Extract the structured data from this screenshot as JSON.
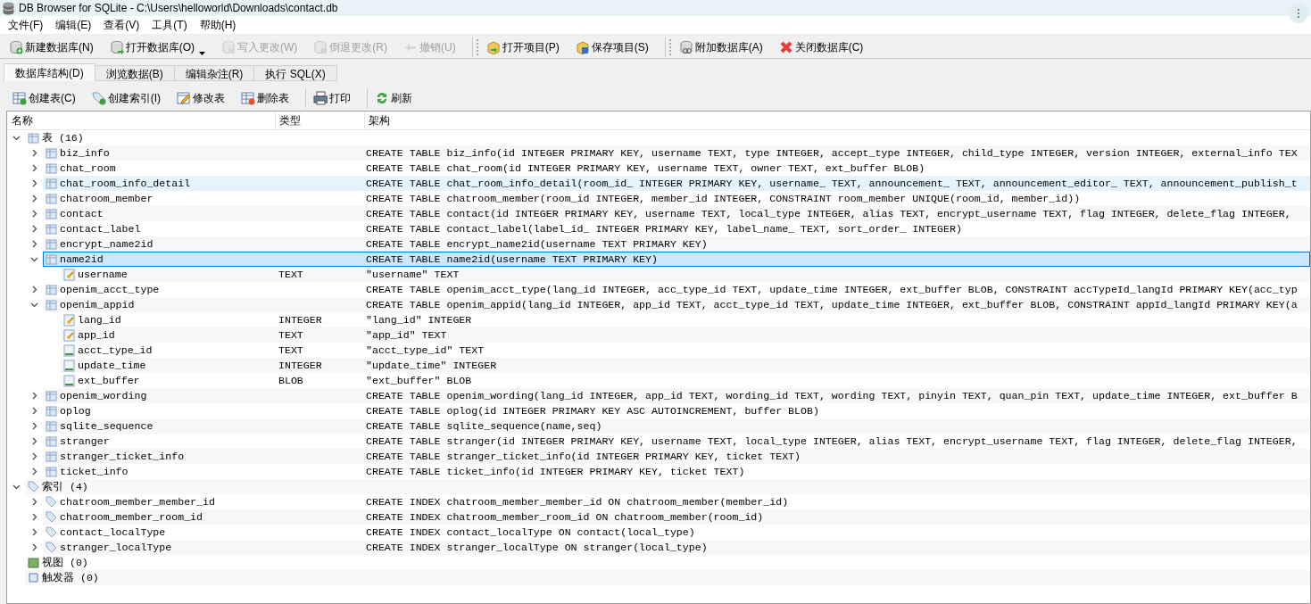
{
  "window": {
    "title": "DB Browser for SQLite - C:\\Users\\helloworld\\Downloads\\contact.db"
  },
  "menu": [
    "文件(F)",
    "编辑(E)",
    "查看(V)",
    "工具(T)",
    "帮助(H)"
  ],
  "toolbar": [
    [
      {
        "kind": "newdb",
        "label": "新建数据库(N)",
        "disabled": false,
        "dropdown": false
      },
      {
        "kind": "opendb",
        "label": "打开数据库(O)",
        "disabled": false,
        "dropdown": true
      },
      {
        "kind": "write",
        "label": "写入更改(W)",
        "disabled": true,
        "dropdown": false
      },
      {
        "kind": "revert",
        "label": "倒退更改(R)",
        "disabled": true,
        "dropdown": false
      },
      {
        "kind": "undo",
        "label": "撤销(U)",
        "disabled": true,
        "dropdown": false
      }
    ],
    [
      {
        "kind": "openproject",
        "label": "打开项目(P)",
        "disabled": false,
        "dropdown": false
      },
      {
        "kind": "saveproject",
        "label": "保存项目(S)",
        "disabled": false,
        "dropdown": false
      }
    ],
    [
      {
        "kind": "attach",
        "label": "附加数据库(A)",
        "disabled": false,
        "dropdown": false
      },
      {
        "kind": "close",
        "label": "关闭数据库(C)",
        "disabled": false,
        "dropdown": false
      }
    ]
  ],
  "tabs": [
    {
      "label": "数据库结构(D)",
      "selected": true
    },
    {
      "label": "浏览数据(B)",
      "selected": false
    },
    {
      "label": "编辑杂注(R)",
      "selected": false
    },
    {
      "label": "执行 SQL(X)",
      "selected": false
    }
  ],
  "structure_toolbar": [
    [
      {
        "kind": "createtable",
        "label": "创建表(C)"
      },
      {
        "kind": "createindex",
        "label": "创建索引(I)"
      },
      {
        "kind": "modifytable",
        "label": "修改表"
      },
      {
        "kind": "deletetable",
        "label": "删除表"
      }
    ],
    [
      {
        "kind": "print",
        "label": "打印"
      }
    ],
    [
      {
        "kind": "refresh",
        "label": "刷新"
      }
    ]
  ],
  "tree": {
    "columns": [
      "名称",
      "类型",
      "架构"
    ],
    "groups": [
      {
        "kind": "tables",
        "label": "表 (16)",
        "expanded": true,
        "children": [
          {
            "name": "biz_info",
            "schema": "CREATE TABLE biz_info(id INTEGER PRIMARY KEY, username TEXT, type INTEGER, accept_type INTEGER, child_type INTEGER, version INTEGER, external_info TEX",
            "expanded": false,
            "selected": false,
            "hovered": false
          },
          {
            "name": "chat_room",
            "schema": "CREATE TABLE chat_room(id INTEGER PRIMARY KEY, username TEXT, owner TEXT, ext_buffer BLOB)",
            "expanded": false,
            "selected": false,
            "hovered": false
          },
          {
            "name": "chat_room_info_detail",
            "schema": "CREATE TABLE chat_room_info_detail(room_id_ INTEGER PRIMARY KEY, username_ TEXT, announcement_ TEXT, announcement_editor_ TEXT, announcement_publish_t",
            "expanded": false,
            "selected": false,
            "hovered": true
          },
          {
            "name": "chatroom_member",
            "schema": "CREATE TABLE chatroom_member(room_id INTEGER, member_id INTEGER, CONSTRAINT room_member UNIQUE(room_id, member_id))",
            "expanded": false,
            "selected": false,
            "hovered": false
          },
          {
            "name": "contact",
            "schema": "CREATE TABLE contact(id INTEGER PRIMARY KEY, username TEXT, local_type INTEGER, alias TEXT, encrypt_username TEXT, flag INTEGER, delete_flag INTEGER,",
            "expanded": false,
            "selected": false,
            "hovered": false
          },
          {
            "name": "contact_label",
            "schema": "CREATE TABLE contact_label(label_id_ INTEGER PRIMARY KEY, label_name_ TEXT, sort_order_ INTEGER)",
            "expanded": false,
            "selected": false,
            "hovered": false
          },
          {
            "name": "encrypt_name2id",
            "schema": "CREATE TABLE encrypt_name2id(username TEXT PRIMARY KEY)",
            "expanded": false,
            "selected": false,
            "hovered": false
          },
          {
            "name": "name2id",
            "schema": "CREATE TABLE name2id(username TEXT PRIMARY KEY)",
            "expanded": true,
            "selected": true,
            "hovered": false,
            "children": [
              {
                "name": "username",
                "type": "TEXT",
                "schema": "\"username\" TEXT",
                "primary_key": true
              }
            ]
          },
          {
            "name": "openim_acct_type",
            "schema": "CREATE TABLE openim_acct_type(lang_id INTEGER, acc_type_id TEXT, update_time INTEGER, ext_buffer BLOB, CONSTRAINT accTypeId_langId PRIMARY KEY(acc_typ",
            "expanded": false,
            "selected": false,
            "hovered": false
          },
          {
            "name": "openim_appid",
            "schema": "CREATE TABLE openim_appid(lang_id INTEGER, app_id TEXT, acct_type_id TEXT, update_time INTEGER, ext_buffer BLOB, CONSTRAINT appId_langId PRIMARY KEY(a",
            "expanded": true,
            "selected": false,
            "hovered": false,
            "children": [
              {
                "name": "lang_id",
                "type": "INTEGER",
                "schema": "\"lang_id\" INTEGER",
                "primary_key": true
              },
              {
                "name": "app_id",
                "type": "TEXT",
                "schema": "\"app_id\" TEXT",
                "primary_key": true
              },
              {
                "name": "acct_type_id",
                "type": "TEXT",
                "schema": "\"acct_type_id\" TEXT",
                "primary_key": false
              },
              {
                "name": "update_time",
                "type": "INTEGER",
                "schema": "\"update_time\" INTEGER",
                "primary_key": false
              },
              {
                "name": "ext_buffer",
                "type": "BLOB",
                "schema": "\"ext_buffer\" BLOB",
                "primary_key": false
              }
            ]
          },
          {
            "name": "openim_wording",
            "schema": "CREATE TABLE openim_wording(lang_id INTEGER, app_id TEXT, wording_id TEXT, wording TEXT, pinyin TEXT, quan_pin TEXT, update_time INTEGER, ext_buffer B",
            "expanded": false,
            "selected": false,
            "hovered": false
          },
          {
            "name": "oplog",
            "schema": "CREATE TABLE oplog(id INTEGER PRIMARY KEY ASC AUTOINCREMENT, buffer BLOB)",
            "expanded": false,
            "selected": false,
            "hovered": false
          },
          {
            "name": "sqlite_sequence",
            "schema": "CREATE TABLE sqlite_sequence(name,seq)",
            "expanded": false,
            "selected": false,
            "hovered": false
          },
          {
            "name": "stranger",
            "schema": "CREATE TABLE stranger(id INTEGER PRIMARY KEY, username TEXT, local_type INTEGER, alias TEXT, encrypt_username TEXT, flag INTEGER, delete_flag INTEGER,",
            "expanded": false,
            "selected": false,
            "hovered": false
          },
          {
            "name": "stranger_ticket_info",
            "schema": "CREATE TABLE stranger_ticket_info(id INTEGER PRIMARY KEY, ticket TEXT)",
            "expanded": false,
            "selected": false,
            "hovered": false
          },
          {
            "name": "ticket_info",
            "schema": "CREATE TABLE ticket_info(id INTEGER PRIMARY KEY, ticket TEXT)",
            "expanded": false,
            "selected": false,
            "hovered": false
          }
        ]
      },
      {
        "kind": "indices",
        "label": "索引 (4)",
        "expanded": true,
        "children": [
          {
            "name": "chatroom_member_member_id",
            "schema": "CREATE INDEX chatroom_member_member_id ON chatroom_member(member_id)",
            "expanded": false,
            "selected": false,
            "hovered": false
          },
          {
            "name": "chatroom_member_room_id",
            "schema": "CREATE INDEX chatroom_member_room_id ON chatroom_member(room_id)",
            "expanded": false,
            "selected": false,
            "hovered": false
          },
          {
            "name": "contact_localType",
            "schema": "CREATE INDEX contact_localType ON contact(local_type)",
            "expanded": false,
            "selected": false,
            "hovered": false
          },
          {
            "name": "stranger_localType",
            "schema": "CREATE INDEX stranger_localType ON stranger(local_type)",
            "expanded": false,
            "selected": false,
            "hovered": false
          }
        ]
      },
      {
        "kind": "views",
        "label": "视图 (0)"
      },
      {
        "kind": "triggers",
        "label": "触发器 (0)"
      }
    ]
  }
}
